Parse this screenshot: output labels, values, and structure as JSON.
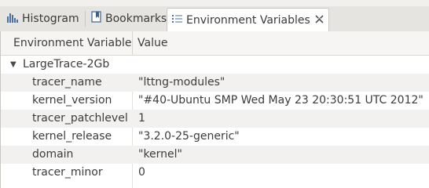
{
  "tabs": [
    {
      "label": "Histogram",
      "icon": "histogram-icon"
    },
    {
      "label": "Bookmarks",
      "icon": "bookmarks-icon"
    },
    {
      "label": "Environment Variables",
      "icon": "list-icon",
      "active": true,
      "close_icon": "close-icon"
    }
  ],
  "table": {
    "columns": [
      "Environment Variable",
      "Value"
    ],
    "group": {
      "label": "LargeTrace-2Gb",
      "expanded": true
    },
    "rows": [
      {
        "name": "tracer_name",
        "value": "\"lttng-modules\""
      },
      {
        "name": "kernel_version",
        "value": "\"#40-Ubuntu SMP Wed May 23 20:30:51 UTC 2012\""
      },
      {
        "name": "tracer_patchlevel",
        "value": "1"
      },
      {
        "name": "kernel_release",
        "value": "\"3.2.0-25-generic\""
      },
      {
        "name": "domain",
        "value": "\"kernel\""
      },
      {
        "name": "tracer_minor",
        "value": "0"
      }
    ]
  },
  "colors": {
    "panel_bg": "#ffffff",
    "stripe_bg": "#f2f1ef",
    "tab_bar_bg": "#e6e4e1"
  }
}
